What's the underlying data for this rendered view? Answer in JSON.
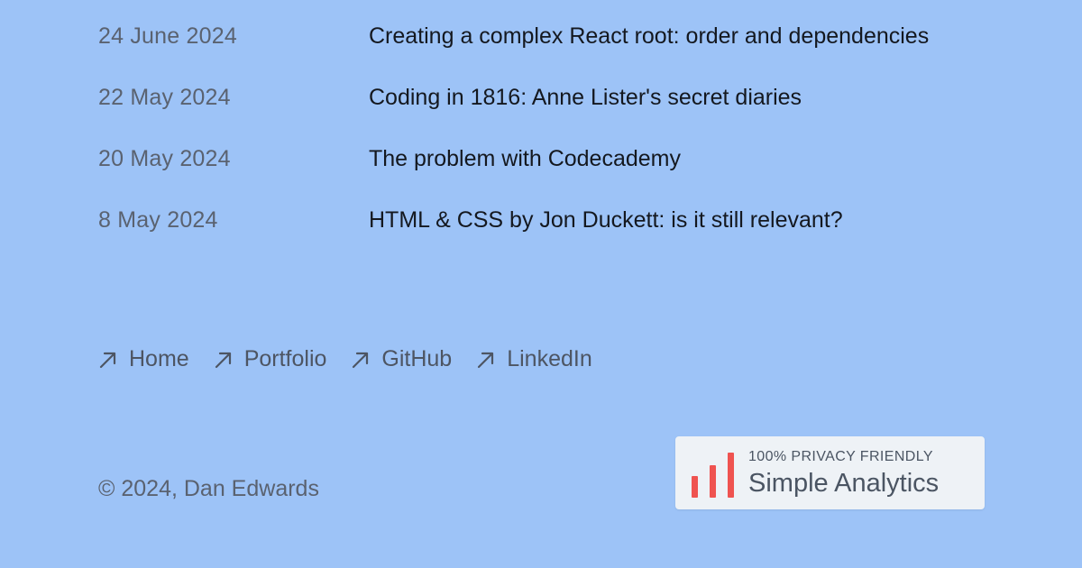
{
  "posts": [
    {
      "date": "24 June 2024",
      "title": "Creating a complex React root: order and dependencies"
    },
    {
      "date": "22 May 2024",
      "title": "Coding in 1816: Anne Lister's secret diaries"
    },
    {
      "date": "20 May 2024",
      "title": "The problem with Codecademy"
    },
    {
      "date": "8 May 2024",
      "title": "HTML & CSS by Jon Duckett: is it still relevant?"
    }
  ],
  "nav": [
    {
      "label": "Home",
      "icon": "arrow-up-right-icon"
    },
    {
      "label": "Portfolio",
      "icon": "arrow-up-right-icon"
    },
    {
      "label": "GitHub",
      "icon": "arrow-up-right-icon"
    },
    {
      "label": "LinkedIn",
      "icon": "arrow-up-right-icon"
    }
  ],
  "footer": {
    "copyright": "© 2024, Dan Edwards"
  },
  "badge": {
    "tagline": "100% PRIVACY FRIENDLY",
    "brand": "Simple Analytics",
    "icon": "bar-chart-icon",
    "bar_color": "#ef5350"
  },
  "colors": {
    "background": "#9dc3f7",
    "title_text": "#14181f",
    "muted_text": "#5a6270"
  }
}
